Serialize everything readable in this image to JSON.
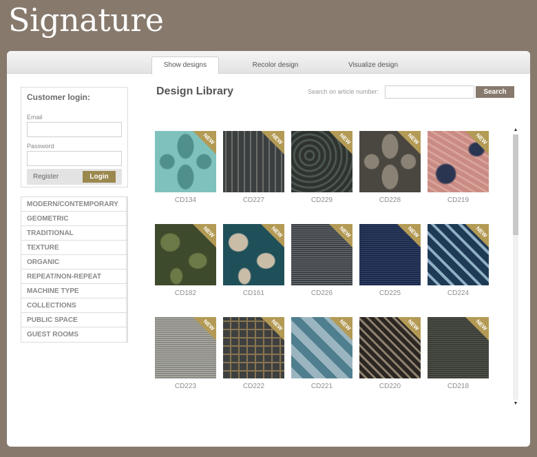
{
  "brand": "Signature",
  "tabs": [
    {
      "label": "Show designs",
      "active": true
    },
    {
      "label": "Recolor design",
      "active": false
    },
    {
      "label": "Visualize design",
      "active": false
    }
  ],
  "login": {
    "title": "Customer login:",
    "email_label": "Email",
    "password_label": "Password",
    "register_label": "Register",
    "login_label": "Login"
  },
  "categories": [
    "MODERN/CONTEMPORARY",
    "GEOMETRIC",
    "TRADITIONAL",
    "TEXTURE",
    "ORGANIC",
    "REPEAT/NON-REPEAT",
    "MACHINE TYPE",
    "COLLECTIONS",
    "PUBLIC SPACE",
    "GUEST ROOMS"
  ],
  "library": {
    "title": "Design Library",
    "search_label": "Search on article number:",
    "search_value": "",
    "search_button": "Search",
    "badge": "NEW",
    "designs": [
      {
        "code": "CD134",
        "colors": [
          "#7fc1bd",
          "#4f8f8c"
        ],
        "pattern": "damask"
      },
      {
        "code": "CD227",
        "colors": [
          "#3b3f40",
          "#6c6e6a"
        ],
        "pattern": "stripes"
      },
      {
        "code": "CD229",
        "colors": [
          "#2e3330",
          "#4c5650"
        ],
        "pattern": "swirl"
      },
      {
        "code": "CD228",
        "colors": [
          "#4a4640",
          "#8a8275"
        ],
        "pattern": "damask"
      },
      {
        "code": "CD219",
        "colors": [
          "#c98b84",
          "#2a3552"
        ],
        "pattern": "marble"
      },
      {
        "code": "CD182",
        "colors": [
          "#3e4a2c",
          "#6b7a46"
        ],
        "pattern": "leaf"
      },
      {
        "code": "CD161",
        "colors": [
          "#1f5059",
          "#c9bda8"
        ],
        "pattern": "leaf"
      },
      {
        "code": "CD226",
        "colors": [
          "#3b3f44",
          "#6e747a"
        ],
        "pattern": "texture"
      },
      {
        "code": "CD225",
        "colors": [
          "#1c2a4a",
          "#33436a"
        ],
        "pattern": "texture"
      },
      {
        "code": "CD224",
        "colors": [
          "#1f3a55",
          "#8fb0c4"
        ],
        "pattern": "geo"
      },
      {
        "code": "CD223",
        "colors": [
          "#8a8a84",
          "#b4b2aa"
        ],
        "pattern": "texture"
      },
      {
        "code": "CD222",
        "colors": [
          "#3e4040",
          "#8a7550"
        ],
        "pattern": "plaid"
      },
      {
        "code": "CD221",
        "colors": [
          "#9bb5c0",
          "#4f7f8f"
        ],
        "pattern": "diamond"
      },
      {
        "code": "CD220",
        "colors": [
          "#2b2622",
          "#8e8270"
        ],
        "pattern": "maze"
      },
      {
        "code": "CD218",
        "colors": [
          "#3a3d36",
          "#55584f"
        ],
        "pattern": "texture"
      }
    ]
  }
}
